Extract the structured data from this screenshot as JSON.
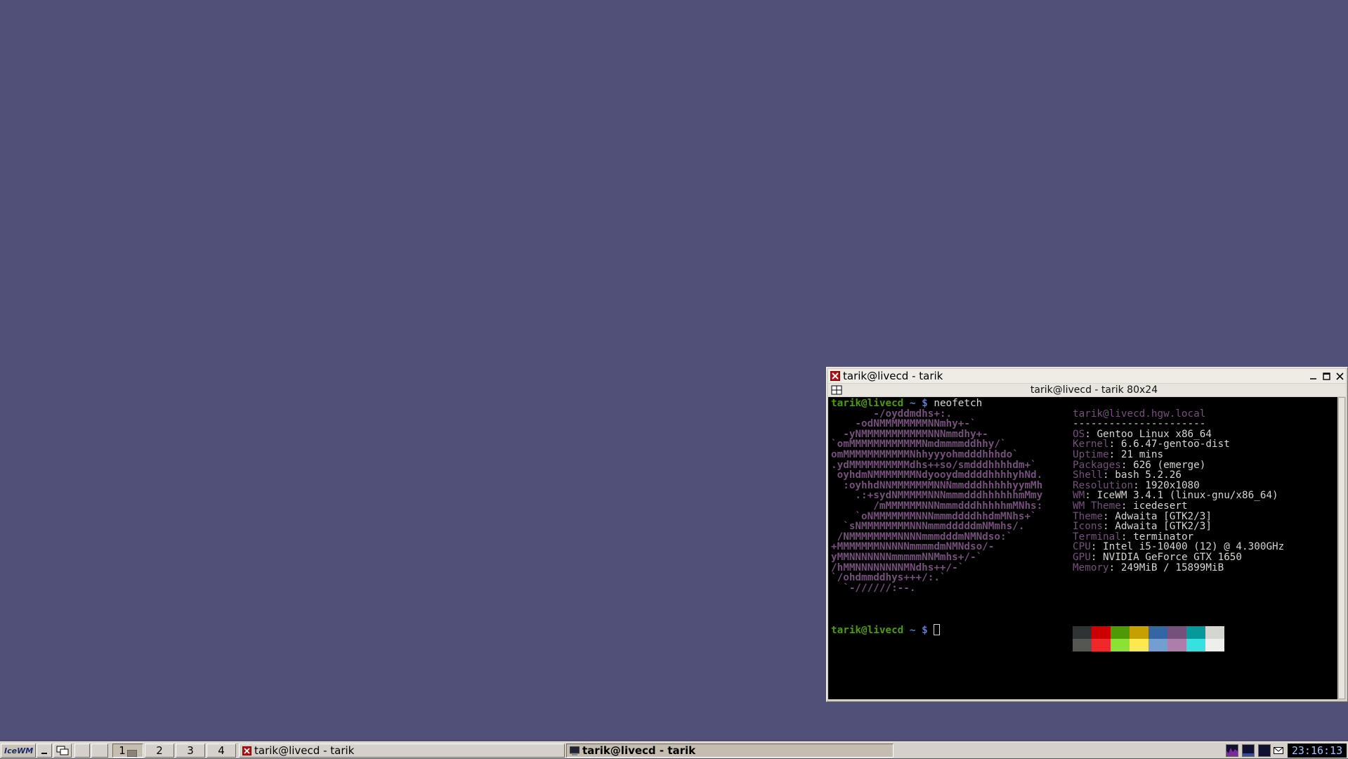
{
  "window": {
    "title": "tarik@livecd - tarik",
    "subtitle": "tarik@livecd - tarik 80x24"
  },
  "terminal": {
    "prompt_user": "tarik@livecd",
    "prompt_tilde": "~",
    "prompt_dollar": "$",
    "command": "neofetch",
    "logo_lines": [
      "       -/oyddmdhs+:.",
      "    -odNMMMMMMMMNNmhy+-`",
      "  -yNMMMMMMMMMMMNNNmmdhy+-",
      "`omMMMMMMMMMMMMNmdmmmmddhhy/`",
      "omMMMMMMMMMMMNhhyyyohmdddhhhdo`",
      ".ydMMMMMMMMMMdhs++so/smdddhhhhdm+`",
      " oyhdmNMMMMMMMNdyooydmddddhhhhyhNd.",
      "  :oyhhdNNMMMMMMMNNNmmdddhhhhhyymMh",
      "    .:+sydNMMMMMNNNmmmdddhhhhhhmMmy",
      "       /mMMMMMMNNNmmmdddhhhhhmMNhs:",
      "    `oNMMMMMMMNNNmmmddddhhdmMNhs+`",
      "  `sNMMMMMMMMNNNmmmdddddmNMmhs/.",
      " /NMMMMMMMMNNNNmmmdddmNMNdso:`",
      "+MMMMMMMNNNNNmmmmdmNMNdso/-",
      "yMMNNNNNNNmmmmmNNMmhs+/-`",
      "/hMMNNNNNNNNMNdhs++/-`",
      "`/ohdmmddhys+++/:.`",
      "  `-//////:--."
    ],
    "info_header": "tarik@livecd.hgw.local",
    "info_separator": "----------------------",
    "info": [
      {
        "key": "OS",
        "value": "Gentoo Linux x86_64"
      },
      {
        "key": "Kernel",
        "value": "6.6.47-gentoo-dist"
      },
      {
        "key": "Uptime",
        "value": "21 mins"
      },
      {
        "key": "Packages",
        "value": "626 (emerge)"
      },
      {
        "key": "Shell",
        "value": "bash 5.2.26"
      },
      {
        "key": "Resolution",
        "value": "1920x1080"
      },
      {
        "key": "WM",
        "value": "IceWM 3.4.1 (linux-gnu/x86_64)"
      },
      {
        "key": "WM Theme",
        "value": "icedesert"
      },
      {
        "key": "Theme",
        "value": "Adwaita [GTK2/3]"
      },
      {
        "key": "Icons",
        "value": "Adwaita [GTK2/3]"
      },
      {
        "key": "Terminal",
        "value": "terminator"
      },
      {
        "key": "CPU",
        "value": "Intel i5-10400 (12) @ 4.300GHz"
      },
      {
        "key": "GPU",
        "value": "NVIDIA GeForce GTX 1650"
      },
      {
        "key": "Memory",
        "value": "249MiB / 15899MiB"
      }
    ],
    "palette_top": [
      "#2e3436",
      "#cc0000",
      "#4e9a06",
      "#c4a000",
      "#3465a4",
      "#75507b",
      "#06989a",
      "#d3d7cf"
    ],
    "palette_bottom": [
      "#555753",
      "#ef2929",
      "#8ae234",
      "#fce94f",
      "#729fcf",
      "#ad7fa8",
      "#34e2e2",
      "#eeeeec"
    ]
  },
  "taskbar": {
    "workspaces": [
      "1",
      "2",
      "3",
      "4"
    ],
    "active_workspace": "1",
    "tasks": [
      {
        "label": "tarik@livecd - tarik",
        "active": false
      },
      {
        "label": "tarik@livecd - tarik",
        "active": true
      }
    ],
    "clock": "23:16:13",
    "start_label": "IceWM"
  },
  "colors": {
    "desktop": "#515079",
    "prompt_green": "#4e9a06",
    "logo_magenta": "#75507b"
  }
}
